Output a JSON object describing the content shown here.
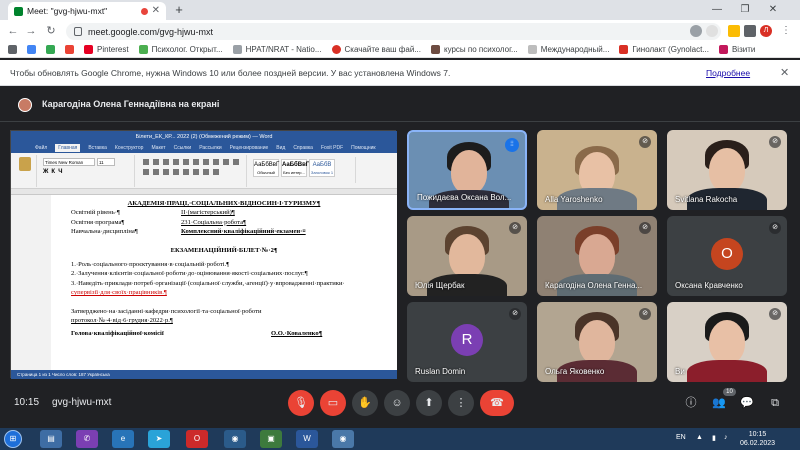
{
  "browser": {
    "tab_title": "Meet: \"gvg-hjwu-mxt\"",
    "url": "meet.google.com/gvg-hjwu-mxt",
    "profile_initial": "Л",
    "bookmarks": [
      "Pinterest",
      "Психолог. Открыт...",
      "НРАТ/NRAT - Natio...",
      "Скачайте ваш фай...",
      "курсы по психолог...",
      "Международный...",
      "Гинолакт (Gynolact...",
      "Візити"
    ],
    "info_message": "Чтобы обновлять Google Chrome, нужна Windows 10 или более поздней версии. У вас установлена Windows 7.",
    "info_link": "Подробнее"
  },
  "meet": {
    "presenter_text": "Карагодіна Олена Геннадіївна на екрані",
    "time": "10:15",
    "meeting_code": "gvg-hjwu-mxt",
    "participants_count": "10",
    "tiles": [
      {
        "name": "Пожидаєва Оксана Вол...",
        "speaking": true
      },
      {
        "name": "Alla Yaroshenko"
      },
      {
        "name": "Svitlana Rakocha"
      },
      {
        "name": "Юлія Щербак"
      },
      {
        "name": "Карагодіна Олена Генна..."
      },
      {
        "name": "Оксана Кравченко",
        "initial": "О",
        "color": "#c5451f"
      },
      {
        "name": "Ruslan Domin",
        "initial": "R",
        "color": "#7b3fb3"
      },
      {
        "name": "Ольга Яковенко"
      },
      {
        "name": "Ви"
      }
    ]
  },
  "word": {
    "title": "Білети_ЕК_КР... 2022 (2) (Обмежений режим) — Word",
    "tabs": [
      "Файл",
      "Главная",
      "Вставка",
      "Конструктор",
      "Макет",
      "Ссылки",
      "Рассылки",
      "Рецензирование",
      "Вид",
      "Справка",
      "Foxit PDF",
      "Помощник"
    ],
    "font": "Times New Roman",
    "font_size": "11",
    "styles": [
      "АаБбВвГ",
      "АаБбВвГ",
      "АаБбВ"
    ],
    "style_names": [
      "Обычный",
      "Без интер...",
      "Заголовок 1"
    ],
    "status": "Страница 1 из 1   Число слов: 187   Українська",
    "doc": {
      "institution": "АКАДЕМІЯ·ПРАЦІ,·СОЦІАЛЬНИХ·ВІДНОСИН·І·ТУРИЗМУ¶",
      "level_label": "Освітній рівень·¶",
      "level_value": "ІІ·(магістерський)¶",
      "program_label": "Освітня·програма¶",
      "program_value": "231·Соціальна·робота¶",
      "disc_label": "Навчальна·дисципліна¶",
      "disc_value": "Комплексний·кваліфікаційний·екзамен·¤",
      "ticket": "ЕКЗАМЕНАЦІЙНИЙ·БІЛЕТ·№·2¶",
      "q1": "1.·Роль·соціального·проєктування·в·соціальній·роботі.¶",
      "q2": "2.·Залучення·клієнтів·соціальної·роботи·до·оцінювання·якості·соціальних·послуг.¶",
      "q3a": "3.·Наведіть·приклади·потреб·організації·(соціальної·служби,·агенції)·у·впровадженні·практики·",
      "q3b": "супервізії·для·своїх·працівників.¶",
      "approved_a": "Затверджено·на·засіданні·кафедри·психології·та·соціальної·роботи",
      "approved_b": "протокол·№·4·від·6·грудня·2022·р.¶",
      "head": "Голова·кваліфікаційної·комісії",
      "head_name": "О.О.·Коваленко¶"
    }
  },
  "taskbar": {
    "lang": "EN",
    "clock_time": "10:15",
    "clock_date": "06.02.2023"
  }
}
